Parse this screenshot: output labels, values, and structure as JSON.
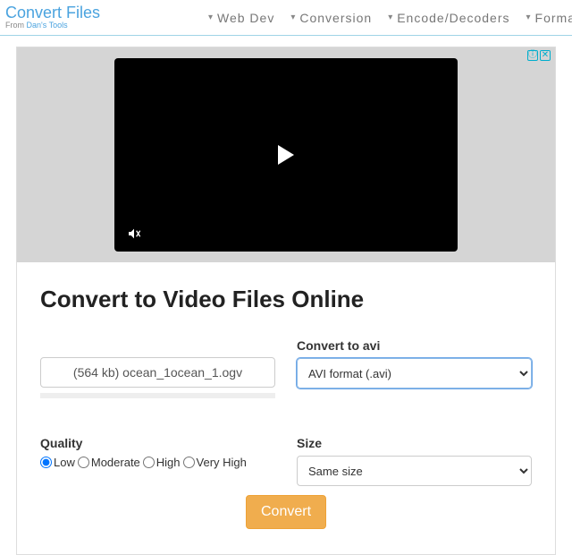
{
  "brand": {
    "title": "Convert Files",
    "sub_prefix": "From ",
    "sub_link": "Dan's Tools"
  },
  "nav": {
    "items": [
      {
        "label": "Web Dev"
      },
      {
        "label": "Conversion"
      },
      {
        "label": "Encode/Decoders"
      },
      {
        "label": "Forma"
      }
    ]
  },
  "ad": {
    "info_glyph": "ⓘ",
    "close_glyph": "✕"
  },
  "main": {
    "heading": "Convert to Video Files Online",
    "file_display": "(564 kb) ocean_1ocean_1.ogv",
    "convert_to_label": "Convert to avi",
    "format_selected": "AVI format (.avi)",
    "quality": {
      "label": "Quality",
      "options": [
        "Low",
        "Moderate",
        "High",
        "Very High"
      ],
      "selected": "Low"
    },
    "size": {
      "label": "Size",
      "selected": "Same size"
    },
    "convert_button": "Convert"
  }
}
